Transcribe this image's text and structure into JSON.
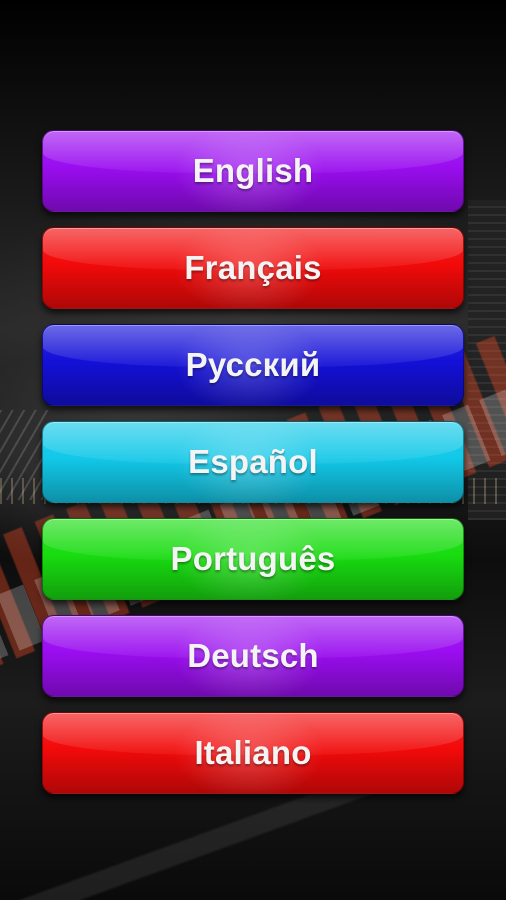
{
  "languages": [
    {
      "label": "English",
      "color": "#9a0df0"
    },
    {
      "label": "Français",
      "color": "#f20a0a"
    },
    {
      "label": "Русский",
      "color": "#1410d8"
    },
    {
      "label": "Español",
      "color": "#12c8e8"
    },
    {
      "label": "Português",
      "color": "#18dc10"
    },
    {
      "label": "Deutsch",
      "color": "#9a0df0"
    },
    {
      "label": "Italiano",
      "color": "#f20a0a"
    }
  ]
}
